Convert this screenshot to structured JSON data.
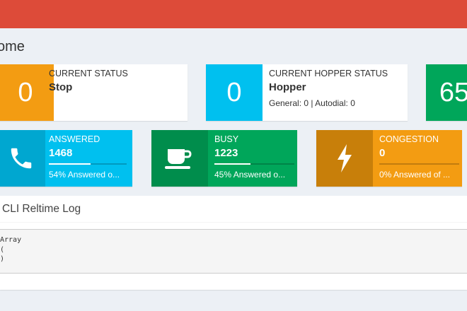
{
  "page": {
    "title": "ome"
  },
  "status_boxes": [
    {
      "icon_value": "0",
      "label": "CURRENT STATUS",
      "value": "Stop",
      "desc": ""
    },
    {
      "icon_value": "0",
      "label": "CURRENT HOPPER STATUS",
      "value": "Hopper",
      "desc": "General: 0 | Autodial: 0"
    },
    {
      "icon_value": "65",
      "label": "",
      "value": "",
      "desc": ""
    }
  ],
  "call_boxes": [
    {
      "icon": "phone-icon",
      "label": "ANSWERED",
      "value": "1468",
      "percent": 54,
      "desc": "54% Answered o..."
    },
    {
      "icon": "coffee-cup-icon",
      "label": "BUSY",
      "value": "1223",
      "percent": 45,
      "desc": "45% Answered o..."
    },
    {
      "icon": "lightning-bolt-icon",
      "label": "CONGESTION",
      "value": "0",
      "percent": 0,
      "desc": "0% Answered of ..."
    }
  ],
  "log": {
    "title": "CLI Reltime Log",
    "content": "Array\n(\n)"
  },
  "colors": {
    "topbar": "#dd4b39",
    "orange": "#f39c12",
    "aqua": "#00c0ef",
    "green": "#00a65a"
  }
}
